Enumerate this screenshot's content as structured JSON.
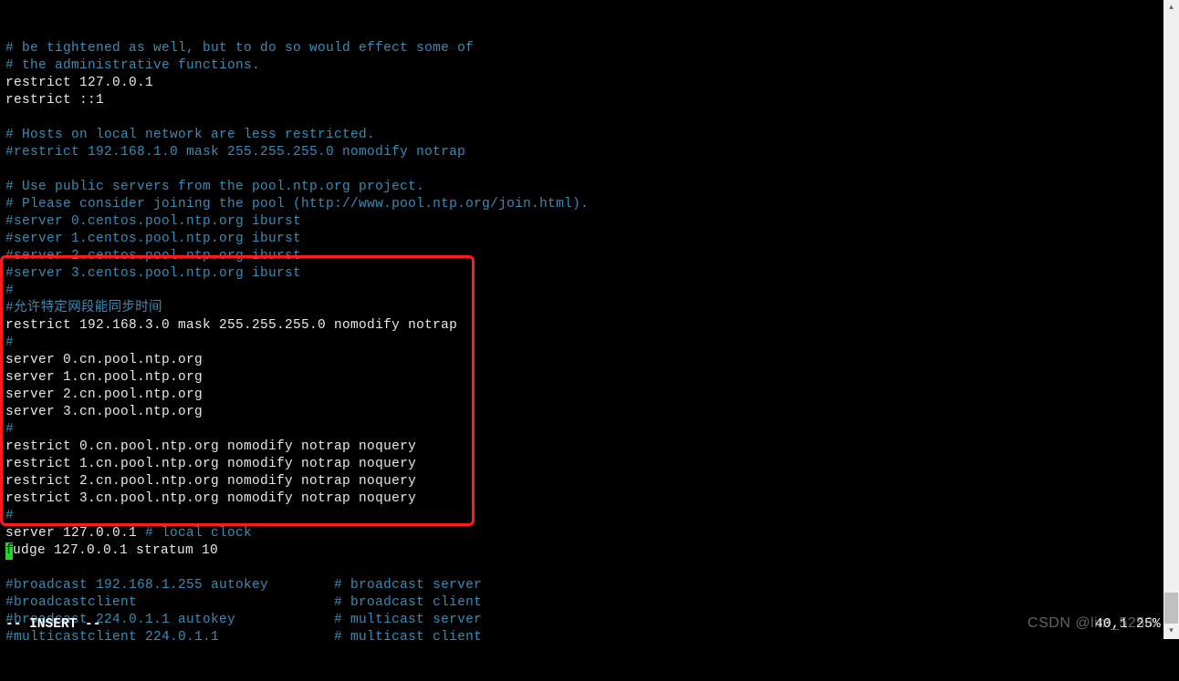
{
  "lines": [
    {
      "segments": [
        {
          "cls": "c",
          "text": "# be tightened as well, but to do so would effect some of"
        }
      ]
    },
    {
      "segments": [
        {
          "cls": "c",
          "text": "# the administrative functions."
        }
      ]
    },
    {
      "segments": [
        {
          "cls": "w",
          "text": "restrict 127.0.0.1"
        }
      ]
    },
    {
      "segments": [
        {
          "cls": "w",
          "text": "restrict ::1"
        }
      ]
    },
    {
      "segments": [
        {
          "cls": "w",
          "text": ""
        }
      ]
    },
    {
      "segments": [
        {
          "cls": "c",
          "text": "# Hosts on local network are less restricted."
        }
      ]
    },
    {
      "segments": [
        {
          "cls": "c",
          "text": "#restrict 192.168.1.0 mask 255.255.255.0 nomodify notrap"
        }
      ]
    },
    {
      "segments": [
        {
          "cls": "w",
          "text": ""
        }
      ]
    },
    {
      "segments": [
        {
          "cls": "c",
          "text": "# Use public servers from the pool.ntp.org project."
        }
      ]
    },
    {
      "segments": [
        {
          "cls": "c",
          "text": "# Please consider joining the pool (http://www.pool.ntp.org/join.html)."
        }
      ]
    },
    {
      "segments": [
        {
          "cls": "c",
          "text": "#server 0.centos.pool.ntp.org iburst"
        }
      ]
    },
    {
      "segments": [
        {
          "cls": "c",
          "text": "#server 1.centos.pool.ntp.org iburst"
        }
      ]
    },
    {
      "segments": [
        {
          "cls": "c",
          "text": "#server 2.centos.pool.ntp.org iburst"
        }
      ]
    },
    {
      "segments": [
        {
          "cls": "c",
          "text": "#server 3.centos.pool.ntp.org iburst"
        }
      ]
    },
    {
      "segments": [
        {
          "cls": "c",
          "text": "#"
        }
      ]
    },
    {
      "segments": [
        {
          "cls": "c",
          "text": "#允许特定网段能同步时间"
        }
      ]
    },
    {
      "segments": [
        {
          "cls": "w",
          "text": "restrict 192.168.3.0 mask 255.255.255.0 nomodify notrap"
        }
      ]
    },
    {
      "segments": [
        {
          "cls": "c",
          "text": "#"
        }
      ]
    },
    {
      "segments": [
        {
          "cls": "w",
          "text": "server 0.cn.pool.ntp.org"
        }
      ]
    },
    {
      "segments": [
        {
          "cls": "w",
          "text": "server 1.cn.pool.ntp.org"
        }
      ]
    },
    {
      "segments": [
        {
          "cls": "w",
          "text": "server 2.cn.pool.ntp.org"
        }
      ]
    },
    {
      "segments": [
        {
          "cls": "w",
          "text": "server 3.cn.pool.ntp.org"
        }
      ]
    },
    {
      "segments": [
        {
          "cls": "c",
          "text": "#"
        }
      ]
    },
    {
      "segments": [
        {
          "cls": "w",
          "text": "restrict 0.cn.pool.ntp.org nomodify notrap noquery"
        }
      ]
    },
    {
      "segments": [
        {
          "cls": "w",
          "text": "restrict 1.cn.pool.ntp.org nomodify notrap noquery"
        }
      ]
    },
    {
      "segments": [
        {
          "cls": "w",
          "text": "restrict 2.cn.pool.ntp.org nomodify notrap noquery"
        }
      ]
    },
    {
      "segments": [
        {
          "cls": "w",
          "text": "restrict 3.cn.pool.ntp.org nomodify notrap noquery"
        }
      ]
    },
    {
      "segments": [
        {
          "cls": "c",
          "text": "#"
        }
      ]
    },
    {
      "segments": [
        {
          "cls": "w",
          "text": "server 127.0.0.1 "
        },
        {
          "cls": "c",
          "text": "# local clock"
        }
      ]
    },
    {
      "segments": [
        {
          "cls": "cursor",
          "text": "f"
        },
        {
          "cls": "w",
          "text": "udge 127.0.0.1 stratum 10"
        }
      ]
    },
    {
      "segments": [
        {
          "cls": "w",
          "text": ""
        }
      ]
    },
    {
      "segments": [
        {
          "cls": "c",
          "text": "#broadcast 192.168.1.255 autokey        # broadcast server"
        }
      ]
    },
    {
      "segments": [
        {
          "cls": "c",
          "text": "#broadcastclient                        # broadcast client"
        }
      ]
    },
    {
      "segments": [
        {
          "cls": "c",
          "text": "#broadcast 224.0.1.1 autokey            # multicast server"
        }
      ]
    },
    {
      "segments": [
        {
          "cls": "c",
          "text": "#multicastclient 224.0.1.1              # multicast client"
        }
      ]
    }
  ],
  "status": {
    "mode": "-- INSERT --",
    "position": "40,1",
    "scroll": "25%"
  },
  "watermark": "CSDN @lim_5258"
}
